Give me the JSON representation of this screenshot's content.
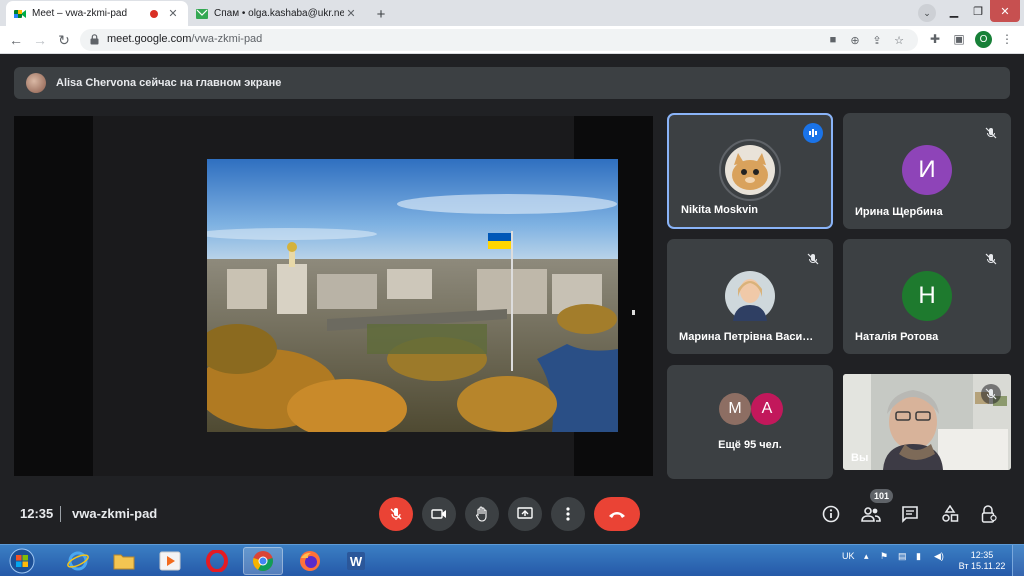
{
  "browser": {
    "tabs": [
      {
        "title": "Meet – vwa-zkmi-pad",
        "close": "✕"
      },
      {
        "title": "Спам • olga.kashaba@ukr.net",
        "close": "✕"
      }
    ],
    "new_tab": "+",
    "url_host": "meet.google.com",
    "url_path": "/vwa-zkmi-pad",
    "profile_initial": "O"
  },
  "banner": {
    "text": "Alisa Chervona сейчас на главном экране"
  },
  "participants": [
    {
      "name": "Nikita Moskvin",
      "speaking": true
    },
    {
      "name": "Ирина Щербина",
      "initial": "И",
      "color": "#8e44b8"
    },
    {
      "name": "Марина Петрівна Васи…"
    },
    {
      "name": "Наталія Ротова",
      "initial": "Н",
      "color": "#1e7a2e"
    },
    {
      "name": "Ещё 95 чел.",
      "initials": [
        "M",
        "A"
      ],
      "colors": [
        "#8d6e63",
        "#c2185b"
      ]
    },
    {
      "name": "Вы"
    }
  ],
  "bottom_bar": {
    "time": "12:35",
    "meeting_code": "vwa-zkmi-pad",
    "people_count": "101"
  },
  "taskbar": {
    "language": "UK",
    "time": "12:35",
    "date": "Вт 15.11.22"
  },
  "colors": {
    "meet_bg": "#202124",
    "tile_bg": "#3c4043",
    "accent_blue": "#8ab4f8",
    "danger_red": "#ea4335"
  }
}
